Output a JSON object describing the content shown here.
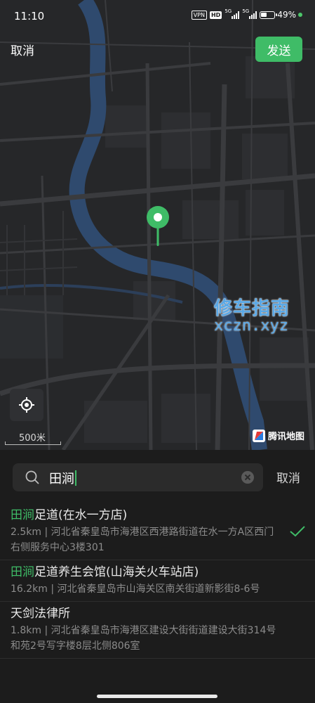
{
  "status_bar": {
    "time": "11:10",
    "vpn": "VPN",
    "hd": "HD",
    "signal1_label": "5G",
    "signal2_label": "5G",
    "battery_percent": "49%",
    "battery_level": 0.49
  },
  "top_bar": {
    "cancel_label": "取消",
    "send_label": "发送"
  },
  "map": {
    "watermark_cn": "修车指南",
    "watermark_en": "xczn.xyz",
    "scale_label": "500米",
    "provider_label": "腾讯地图",
    "colors": {
      "background": "#262729",
      "river": "#2f4a6e",
      "road": "#3a3b3e",
      "pin": "#3fbc67"
    }
  },
  "search": {
    "query": "田涧",
    "cancel_label": "取消"
  },
  "results": [
    {
      "highlight": "田涧",
      "rest": "足道(在水一方店)",
      "address": "2.5km | 河北省秦皇岛市海港区西港路街道在水一方A区西门右侧服务中心3楼301",
      "selected": true
    },
    {
      "highlight": "田涧",
      "rest": "足道养生会馆(山海关火车站店)",
      "address": "16.2km | 河北省秦皇岛市山海关区南关街道新影街8-6号",
      "selected": false
    },
    {
      "highlight": "",
      "rest": "天剑法律所",
      "address": "1.8km | 河北省秦皇岛市海港区建设大街街道建设大街314号和苑2号写字楼8层北侧806室",
      "selected": false
    }
  ],
  "accent_color": "#3fbc67"
}
